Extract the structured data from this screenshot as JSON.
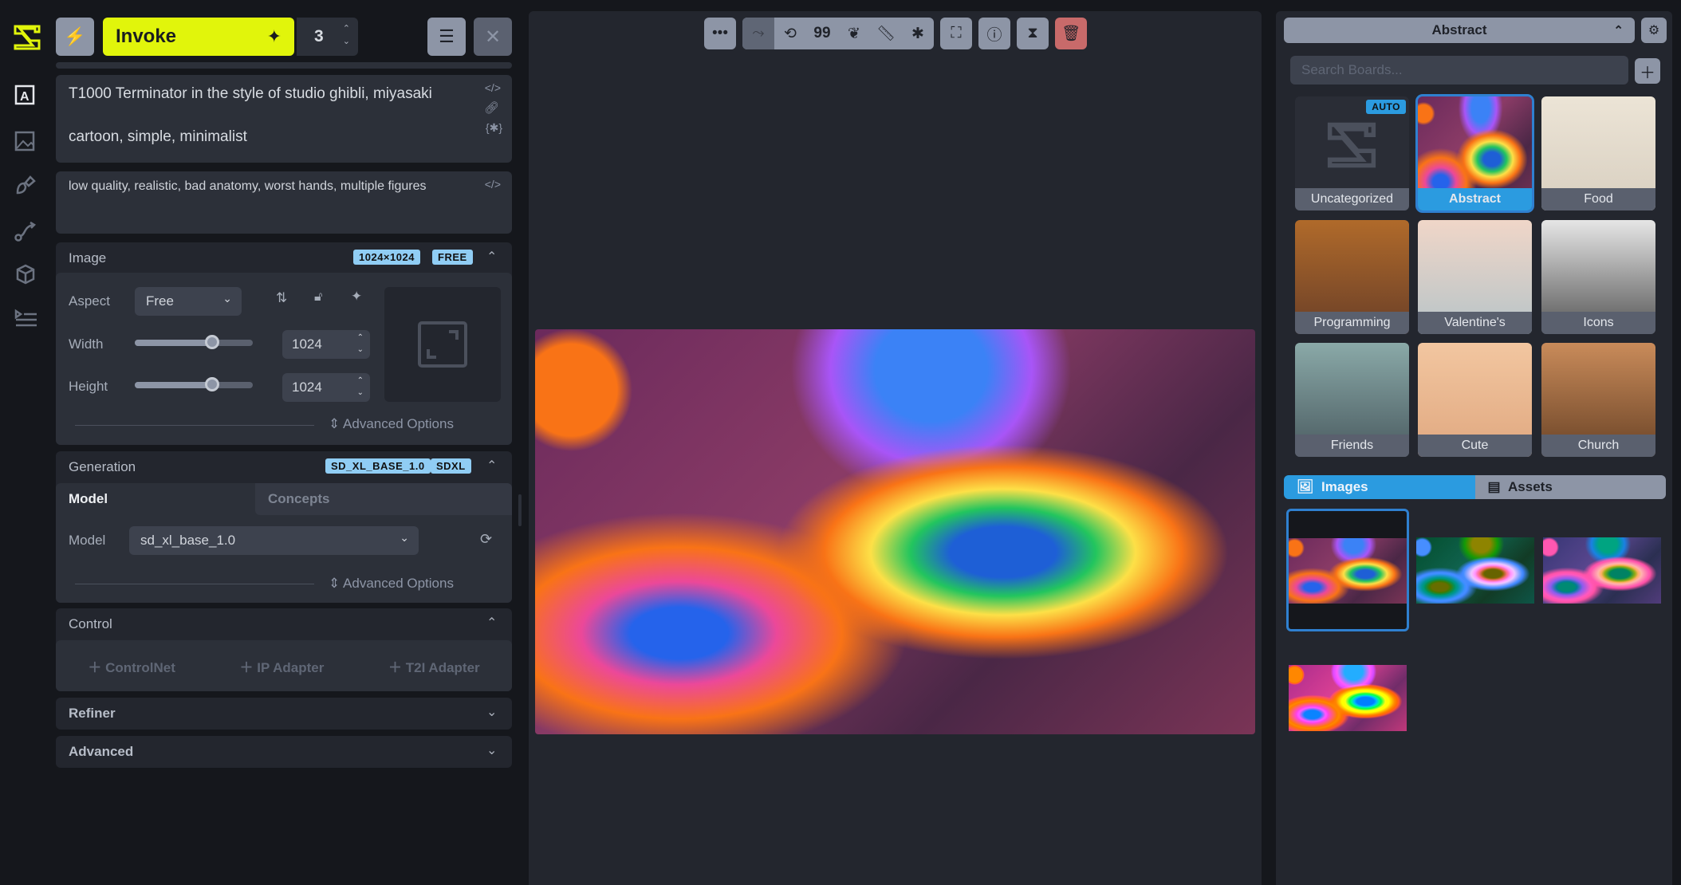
{
  "app": {
    "accent": "#e1f50b",
    "logo": "invoke-logo"
  },
  "rail": {
    "items": [
      {
        "name": "text-to-image",
        "icon": "text-box-icon"
      },
      {
        "name": "image-to-image",
        "icon": "image-icon"
      },
      {
        "name": "canvas",
        "icon": "brush-icon"
      },
      {
        "name": "workflows",
        "icon": "flow-icon"
      },
      {
        "name": "models",
        "icon": "cube-icon"
      },
      {
        "name": "queue",
        "icon": "list-icon"
      }
    ]
  },
  "top": {
    "invoke_label": "Invoke",
    "iterations": "3"
  },
  "prompt": {
    "positive": "T1000 Terminator in the style of studio ghibli, miyasaki\n\ncartoon, simple, minimalist",
    "negative": "low quality, realistic, bad anatomy, worst hands, multiple figures"
  },
  "image_section": {
    "title": "Image",
    "badges": [
      "1024×1024",
      "FREE"
    ],
    "aspect_label": "Aspect",
    "aspect_value": "Free",
    "width_label": "Width",
    "width_value": "1024",
    "height_label": "Height",
    "height_value": "1024",
    "slider_fraction": 0.65,
    "advanced": "Advanced Options"
  },
  "generation": {
    "title": "Generation",
    "badges": [
      "SD_XL_BASE_1.0",
      "SDXL"
    ],
    "tabs": [
      "Model",
      "Concepts"
    ],
    "model_label": "Model",
    "model_value": "sd_xl_base_1.0",
    "advanced": "Advanced Options"
  },
  "control": {
    "title": "Control",
    "buttons": [
      "ControlNet",
      "IP Adapter",
      "T2I Adapter"
    ]
  },
  "refiner": {
    "title": "Refiner"
  },
  "advanced": {
    "title": "Advanced"
  },
  "boards": {
    "selected": "Abstract",
    "search_placeholder": "Search Boards...",
    "auto_badge": "AUTO",
    "items": [
      "Uncategorized",
      "Abstract",
      "Food",
      "Programming",
      "Valentine's",
      "Icons",
      "Friends",
      "Cute",
      "Church"
    ]
  },
  "gallery": {
    "tabs": [
      "Images",
      "Assets"
    ],
    "active_tab": "Images",
    "selected_color": "#2f80d0"
  }
}
